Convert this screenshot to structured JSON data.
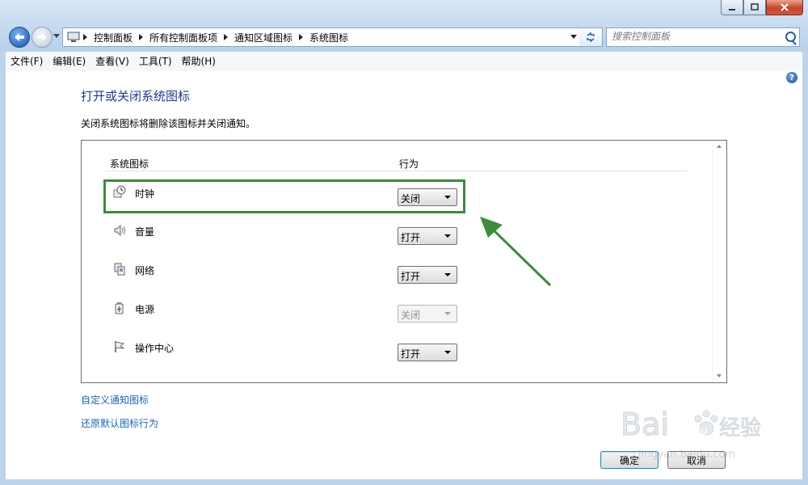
{
  "breadcrumb": [
    "控制面板",
    "所有控制面板项",
    "通知区域图标",
    "系统图标"
  ],
  "search": {
    "placeholder": "搜索控制面板"
  },
  "menu": [
    "文件(F)",
    "编辑(E)",
    "查看(V)",
    "工具(T)",
    "帮助(H)"
  ],
  "page": {
    "title": "打开或关闭系统图标",
    "description": "关闭系统图标将删除该图标并关闭通知。"
  },
  "table": {
    "headers": [
      "系统图标",
      "行为"
    ],
    "rows": [
      {
        "name": "时钟",
        "icon": "clock-icon",
        "value": "关闭",
        "enabled": true
      },
      {
        "name": "音量",
        "icon": "speaker-icon",
        "value": "打开",
        "enabled": true
      },
      {
        "name": "网络",
        "icon": "network-icon",
        "value": "打开",
        "enabled": true
      },
      {
        "name": "电源",
        "icon": "power-icon",
        "value": "关闭",
        "enabled": false
      },
      {
        "name": "操作中心",
        "icon": "flag-icon",
        "value": "打开",
        "enabled": true
      }
    ]
  },
  "links": {
    "customize": "自定义通知图标",
    "restore": "还原默认图标行为"
  },
  "buttons": {
    "ok": "确定",
    "cancel": "取消"
  },
  "watermark": {
    "brand": "Bai",
    "brand2": "du",
    "cn": "经验",
    "url": "jingyan.baidu.com"
  },
  "colors": {
    "highlight": "#3c8c3c",
    "link": "#1c63b4",
    "title": "#1e3c8c"
  }
}
